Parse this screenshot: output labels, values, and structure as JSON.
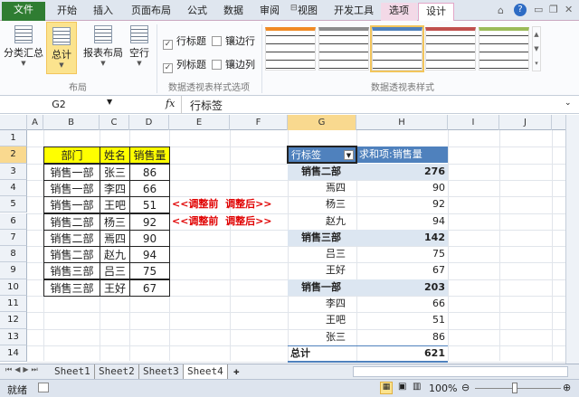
{
  "tabs": {
    "file": "文件",
    "items": [
      "开始",
      "插入",
      "页面布局",
      "公式",
      "数据",
      "审阅",
      "视图",
      "开发工具",
      "选项",
      "设计"
    ],
    "active": "设计"
  },
  "ribbon": {
    "layout": {
      "buttons": [
        "分类汇总",
        "总计",
        "报表布局",
        "空行"
      ],
      "label": "布局"
    },
    "options": {
      "row_headers": "行标题",
      "col_headers": "列标题",
      "banded_rows": "镶边行",
      "banded_cols": "镶边列",
      "row_headers_checked": true,
      "col_headers_checked": true,
      "banded_rows_checked": false,
      "banded_cols_checked": false,
      "label": "数据透视表样式选项"
    },
    "styles": {
      "label": "数据透视表样式",
      "colors": [
        "#f08a24",
        "#8c8c8c",
        "#4f81bd",
        "#c0504d",
        "#9bbb59"
      ]
    }
  },
  "formula": {
    "name_box": "G2",
    "fx": "fx",
    "value": "行标签"
  },
  "columns": [
    "A",
    "B",
    "C",
    "D",
    "E",
    "F",
    "G",
    "H",
    "I",
    "J"
  ],
  "rows": [
    "1",
    "2",
    "3",
    "4",
    "5",
    "6",
    "7",
    "8",
    "9",
    "10",
    "11",
    "12",
    "13",
    "14"
  ],
  "source_table": {
    "headers": [
      "部门",
      "姓名",
      "销售量"
    ],
    "rows": [
      [
        "销售一部",
        "张三",
        "86"
      ],
      [
        "销售一部",
        "李四",
        "66"
      ],
      [
        "销售一部",
        "王吧",
        "51"
      ],
      [
        "销售二部",
        "杨三",
        "92"
      ],
      [
        "销售二部",
        "焉四",
        "90"
      ],
      [
        "销售二部",
        "赵九",
        "94"
      ],
      [
        "销售三部",
        "吕三",
        "75"
      ],
      [
        "销售三部",
        "王好",
        "67"
      ]
    ]
  },
  "annotations": [
    "<<调整前  调整后>>",
    "<<调整前  调整后>>"
  ],
  "pivot": {
    "header_row": "行标签",
    "header_value": "求和项:销售量",
    "groups": [
      {
        "name": "销售二部",
        "total": "276",
        "items": [
          [
            "焉四",
            "90"
          ],
          [
            "杨三",
            "92"
          ],
          [
            "赵九",
            "94"
          ]
        ]
      },
      {
        "name": "销售三部",
        "total": "142",
        "items": [
          [
            "吕三",
            "75"
          ],
          [
            "王好",
            "67"
          ]
        ]
      },
      {
        "name": "销售一部",
        "total": "203",
        "items": [
          [
            "李四",
            "66"
          ],
          [
            "王吧",
            "51"
          ],
          [
            "张三",
            "86"
          ]
        ]
      }
    ],
    "grand_label": "总计",
    "grand_total": "621"
  },
  "sheets": [
    "Sheet1",
    "Sheet2",
    "Sheet3",
    "Sheet4"
  ],
  "active_sheet": "Sheet4",
  "status": {
    "ready": "就绪",
    "zoom": "100%"
  }
}
